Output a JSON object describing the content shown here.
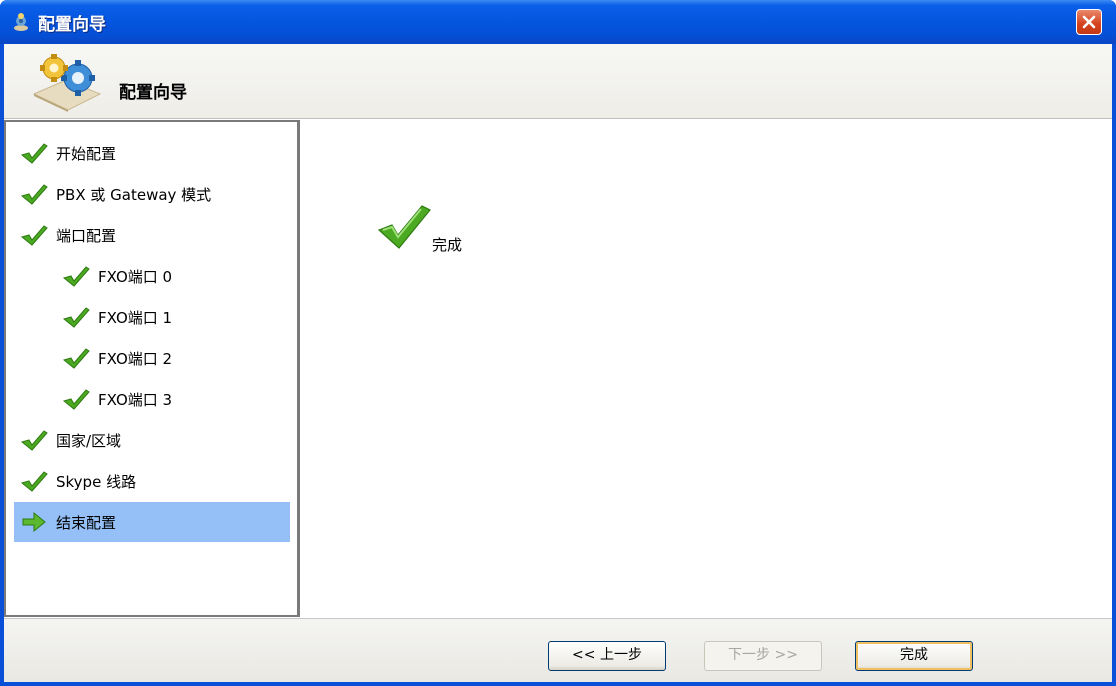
{
  "window": {
    "title": "配置向导",
    "close_icon": "close-icon",
    "app_icon": "wizard-app-icon"
  },
  "header": {
    "title": "配置向导",
    "icon": "gears-icon"
  },
  "steps": [
    {
      "label": "开始配置",
      "status": "done"
    },
    {
      "label": "PBX 或 Gateway 模式",
      "status": "done"
    },
    {
      "label": "端口配置",
      "status": "done"
    },
    {
      "label": "FXO端口 0",
      "status": "done"
    },
    {
      "label": "FXO端口 1",
      "status": "done"
    },
    {
      "label": "FXO端口 2",
      "status": "done"
    },
    {
      "label": "FXO端口 3",
      "status": "done"
    },
    {
      "label": "国家/区域",
      "status": "done"
    },
    {
      "label": "Skype 线路",
      "status": "done"
    },
    {
      "label": "结束配置",
      "status": "current"
    }
  ],
  "main": {
    "status_label": "完成",
    "status_icon": "checkmark-icon"
  },
  "footer": {
    "back_label": "<< 上一步",
    "next_label": "下一步 >>",
    "finish_label": "完成"
  },
  "colors": {
    "titlebar": "#0556e0",
    "selection": "#94c0f7",
    "check": "#4caa22"
  }
}
